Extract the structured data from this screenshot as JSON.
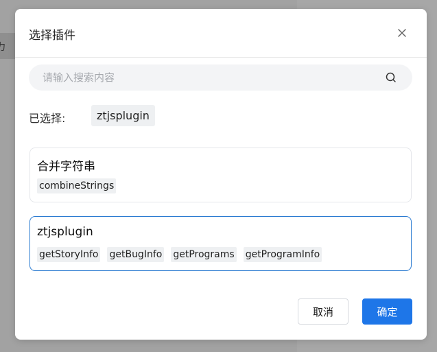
{
  "background": {
    "left_fragment_text": "力"
  },
  "dialog": {
    "title": "选择插件",
    "close_icon": "close-icon",
    "search": {
      "placeholder": "请输入搜索内容",
      "value": "",
      "icon": "search-icon"
    },
    "selected": {
      "label": "已选择:",
      "value": "ztjsplugin"
    },
    "plugins": [
      {
        "name": "合并字符串",
        "selected": false,
        "functions": [
          "combineStrings"
        ]
      },
      {
        "name": "ztjsplugin",
        "selected": true,
        "functions": [
          "getStoryInfo",
          "getBugInfo",
          "getPrograms",
          "getProgramInfo"
        ]
      }
    ],
    "buttons": {
      "cancel_label": "取消",
      "ok_label": "确定"
    }
  },
  "colors": {
    "accent": "#1e76e8",
    "selected_border": "#2b7bd1",
    "tag_background": "#eef0f2"
  }
}
